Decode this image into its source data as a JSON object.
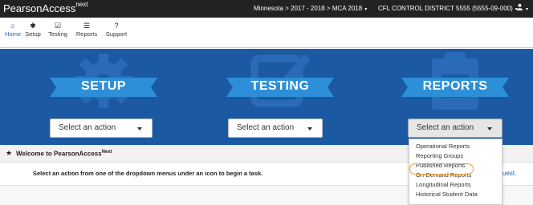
{
  "header": {
    "brand": "PearsonAccess",
    "brand_sup": "next",
    "context": "Minnesota > 2017 - 2018 > MCA 2018",
    "district": "CFL CONTROL DISTRICT 5555 (5555-09-000)",
    "caret": "▾",
    "user_icon": "user-icon"
  },
  "nav": {
    "items": [
      {
        "label": "Home",
        "icon": "home-icon",
        "glyph": "⌂"
      },
      {
        "label": "Setup",
        "icon": "gear-icon",
        "glyph": "✱"
      },
      {
        "label": "Testing",
        "icon": "checkbox-icon",
        "glyph": "☑"
      },
      {
        "label": "Reports",
        "icon": "list-icon",
        "glyph": "☰"
      },
      {
        "label": "Support",
        "icon": "question-icon",
        "glyph": "?"
      }
    ]
  },
  "panels": [
    {
      "title": "SETUP",
      "select_label": "Select an action"
    },
    {
      "title": "TESTING",
      "select_label": "Select an action"
    },
    {
      "title": "REPORTS",
      "select_label": "Select an action"
    }
  ],
  "welcome": {
    "title": "Welcome to PearsonAccess",
    "title_sup": "Next",
    "instruction": "Select an action from one of the dropdown menus under an icon to begin a task.",
    "trailing": "uest."
  },
  "reports_menu": {
    "items": [
      "Operational Reports",
      "Reporting Groups",
      "Published Reports",
      "On-Demand Reports",
      "Longitudinal Reports",
      "Historical Student Data"
    ],
    "highlighted": "Published Reports"
  },
  "colors": {
    "topbar": "#222222",
    "hero": "#1b5aa3",
    "link": "#1a66b3",
    "highlight": "#f0a32c"
  }
}
